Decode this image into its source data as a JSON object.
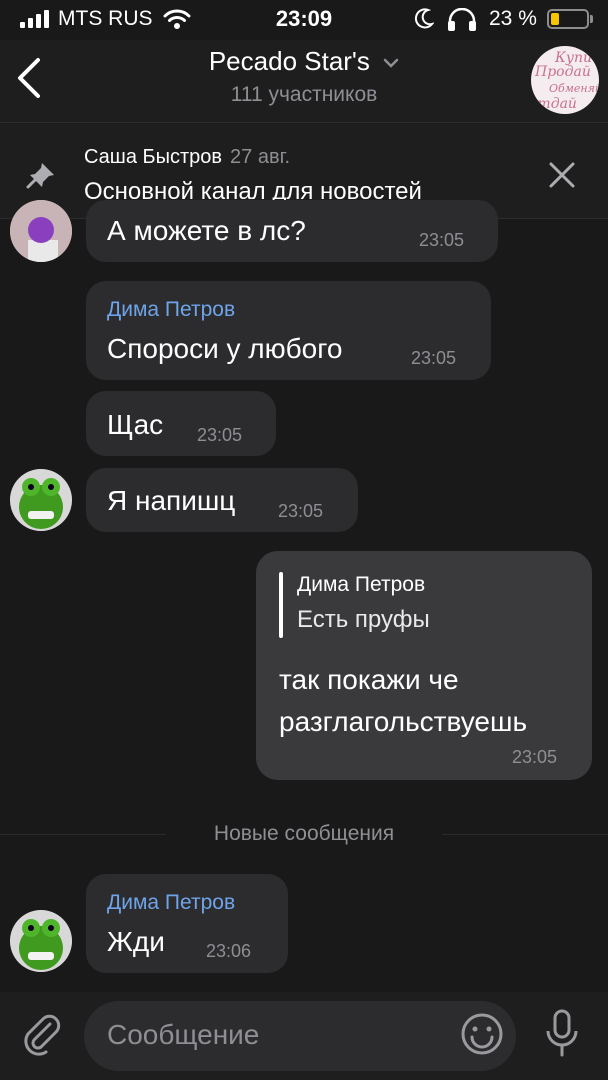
{
  "status_bar": {
    "carrier": "MTS RUS",
    "time": "23:09",
    "battery_percent": "23 %",
    "battery_level": 0.23,
    "battery_color": "#f6c600"
  },
  "header": {
    "title": "Pecado Star's",
    "subtitle": "111 участников",
    "avatar_text": [
      "Купи",
      "Продай",
      "Обменяй",
      "отдай"
    ]
  },
  "pinned": {
    "author": "Саша Быстров",
    "date": "27 авг.",
    "text": "Основной канал для новостей"
  },
  "messages": [
    {
      "text": "А можете в лс?",
      "time": "23:05"
    },
    {
      "author": "Дима Петров",
      "text": "Спороси у любого",
      "time": "23:05"
    },
    {
      "text": "Щас",
      "time": "23:05"
    },
    {
      "text": "Я напишц",
      "time": "23:05"
    },
    {
      "outgoing": true,
      "reply_author": "Дима Петров",
      "reply_text": "Есть пруфы",
      "text_lines": [
        "так покажи че",
        "разглагольствуешь"
      ],
      "time": "23:05"
    },
    {
      "author": "Дима Петров",
      "text": "Жди",
      "time": "23:06"
    }
  ],
  "divider": {
    "label": "Новые сообщения"
  },
  "input": {
    "placeholder": "Сообщение"
  },
  "colors": {
    "accent": "#6ea4e8",
    "background": "#19191a",
    "bubble": "#2c2c2e",
    "outgoing_bubble": "#3a3a3c"
  }
}
